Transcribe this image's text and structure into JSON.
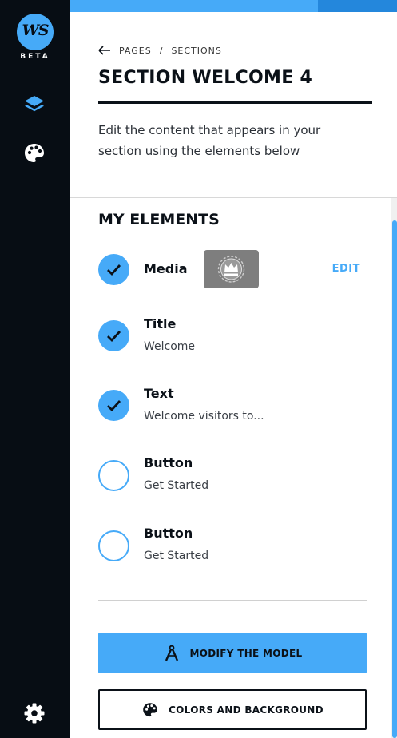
{
  "sidebar": {
    "logo_text": "WS",
    "beta_label": "BETA",
    "icons": [
      "layers-icon",
      "palette-icon",
      "gear-icon"
    ]
  },
  "breadcrumb": {
    "back_icon": "arrow-left-icon",
    "items": [
      "PAGES",
      "SECTIONS"
    ],
    "separator": "/"
  },
  "page": {
    "title": "SECTION WELCOME 4",
    "description": "Edit the content that appears in your section using the elements below"
  },
  "elements": {
    "heading": "MY ELEMENTS",
    "items": [
      {
        "name": "Media",
        "sub": "",
        "checked": true,
        "has_thumbnail": true,
        "action": "EDIT"
      },
      {
        "name": "Title",
        "sub": "Welcome",
        "checked": true
      },
      {
        "name": "Text",
        "sub": "Welcome visitors to...",
        "checked": true
      },
      {
        "name": "Button",
        "sub": "Get Started",
        "checked": false
      },
      {
        "name": "Button",
        "sub": "Get Started",
        "checked": false
      }
    ]
  },
  "actions": {
    "modify_label": "MODIFY THE MODEL",
    "modify_icon": "compass-icon",
    "colors_label": "COLORS AND BACKGROUND",
    "colors_icon": "palette-icon"
  },
  "colors": {
    "sidebar_bg": "#070d14",
    "accent": "#46aaf8",
    "accent_dark": "#2487dc",
    "text": "#0b1118"
  }
}
